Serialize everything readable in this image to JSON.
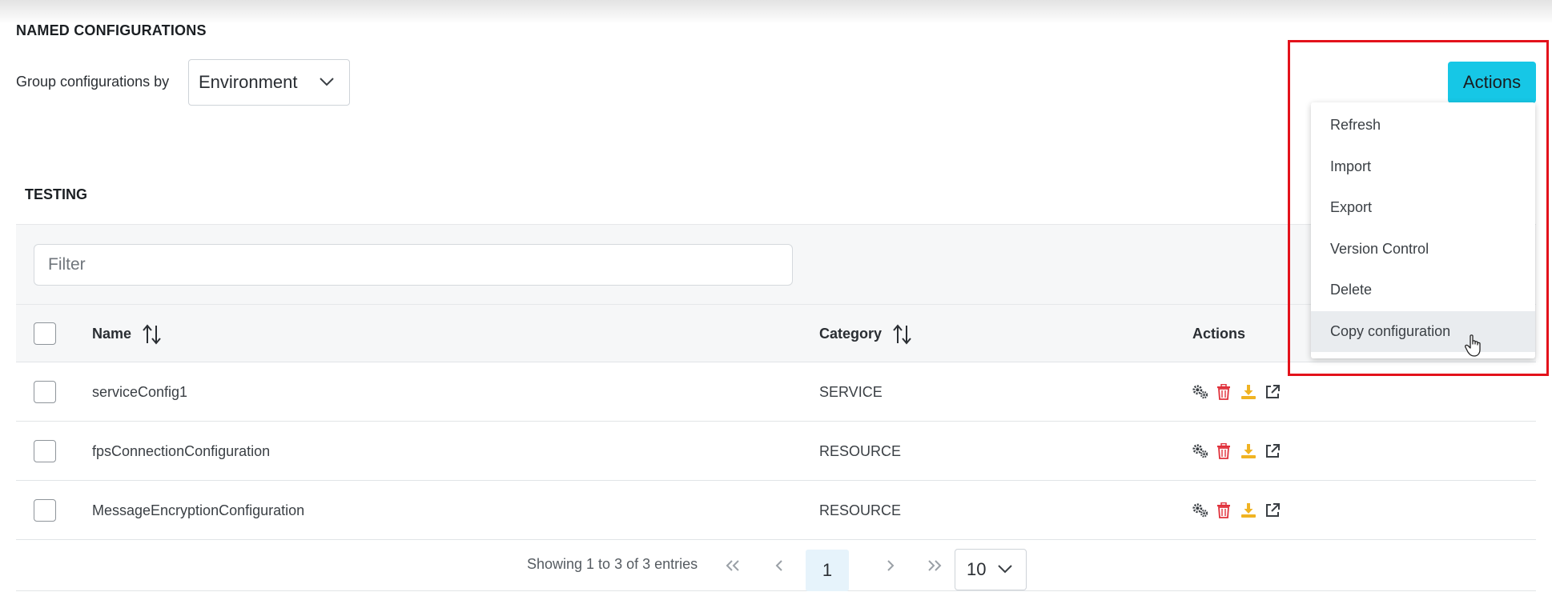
{
  "page": {
    "section_title": "NAMED CONFIGURATIONS",
    "group_by_label": "Group configurations by",
    "group_by_value": "Environment",
    "actions_button": "Actions"
  },
  "actions_menu": {
    "items": [
      "Refresh",
      "Import",
      "Export",
      "Version Control",
      "Delete",
      "Copy configuration"
    ],
    "hovered_item": "Copy configuration"
  },
  "group": {
    "title": "TESTING",
    "filter_placeholder": "Filter"
  },
  "table": {
    "headers": {
      "name": "Name",
      "category": "Category",
      "actions": "Actions"
    },
    "rows": [
      {
        "name": "serviceConfig1",
        "category": "SERVICE"
      },
      {
        "name": "fpsConnectionConfiguration",
        "category": "RESOURCE"
      },
      {
        "name": "MessageEncryptionConfiguration",
        "category": "RESOURCE"
      }
    ],
    "row_action_icons": [
      "settings-icon",
      "delete-icon",
      "download-icon",
      "open-external-icon"
    ]
  },
  "pagination": {
    "summary": "Showing 1 to 3 of 3 entries",
    "current_page": "1",
    "page_size": "10"
  },
  "colors": {
    "accent": "#16c7e6",
    "highlight_border": "#e3121b",
    "delete_icon": "#e0313b",
    "download_icon": "#f0b323"
  }
}
